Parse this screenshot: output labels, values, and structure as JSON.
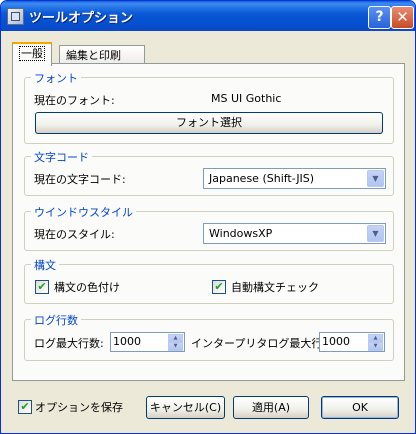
{
  "window": {
    "title": "ツールオプション",
    "help_icon": "?",
    "close_icon": "✕"
  },
  "tabs": [
    {
      "label": "一般"
    },
    {
      "label": "編集と印刷"
    }
  ],
  "font_group": {
    "legend": "フォント",
    "current_label": "現在のフォント:",
    "current_value": "MS UI Gothic",
    "select_button": "フォント選択"
  },
  "charset_group": {
    "legend": "文字コード",
    "current_label": "現在の文字コード:",
    "selected": "Japanese (Shift-JIS)"
  },
  "window_style_group": {
    "legend": "ウインドウスタイル",
    "current_label": "現在のスタイル:",
    "selected": "WindowsXP"
  },
  "syntax_group": {
    "legend": "構文",
    "coloring_label": "構文の色付け",
    "coloring_checked": true,
    "auto_check_label": "自動構文チェック",
    "auto_check_checked": true
  },
  "log_group": {
    "legend": "ログ行数",
    "max_lines_label": "ログ最大行数:",
    "max_lines_value": "1000",
    "interpreter_label": "インタープリタログ最大行数:",
    "interpreter_value": "1000"
  },
  "footer": {
    "save_options_label": "オプションを保存",
    "save_options_checked": true,
    "cancel_label": "キャンセル(C)",
    "apply_label": "適用(A)",
    "ok_label": "OK"
  }
}
